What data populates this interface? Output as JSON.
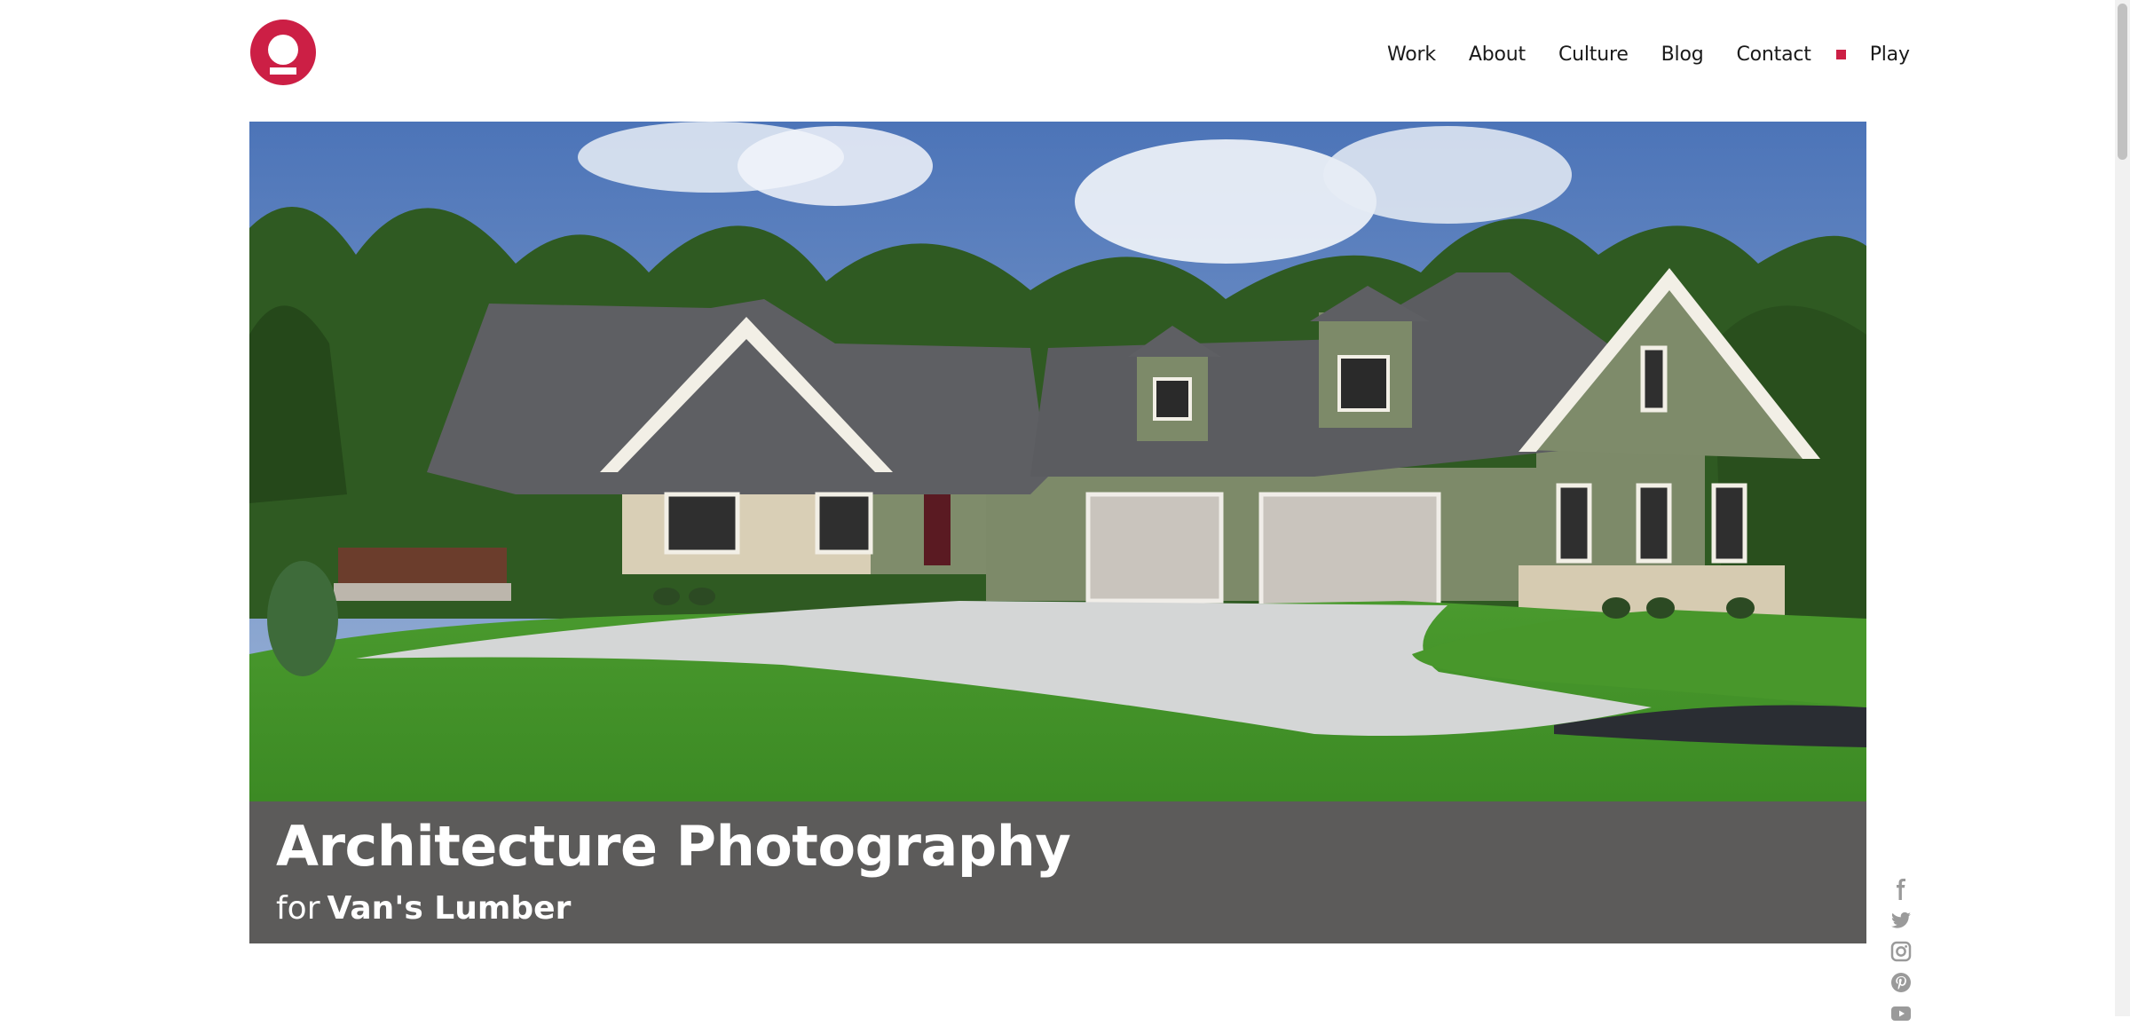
{
  "brand": {
    "accent": "#cc1f45"
  },
  "nav": {
    "items": [
      {
        "label": "Work"
      },
      {
        "label": "About"
      },
      {
        "label": "Culture"
      },
      {
        "label": "Blog"
      },
      {
        "label": "Contact"
      },
      {
        "label": "Play"
      }
    ]
  },
  "hero": {
    "image_subject": "house-photo",
    "title": "Architecture Photography",
    "for_label": "for",
    "client": "Van's Lumber",
    "caption_bg": "#5c5b5a"
  },
  "social": {
    "icons": [
      "facebook-icon",
      "twitter-icon",
      "instagram-icon",
      "pinterest-icon",
      "youtube-icon"
    ]
  }
}
